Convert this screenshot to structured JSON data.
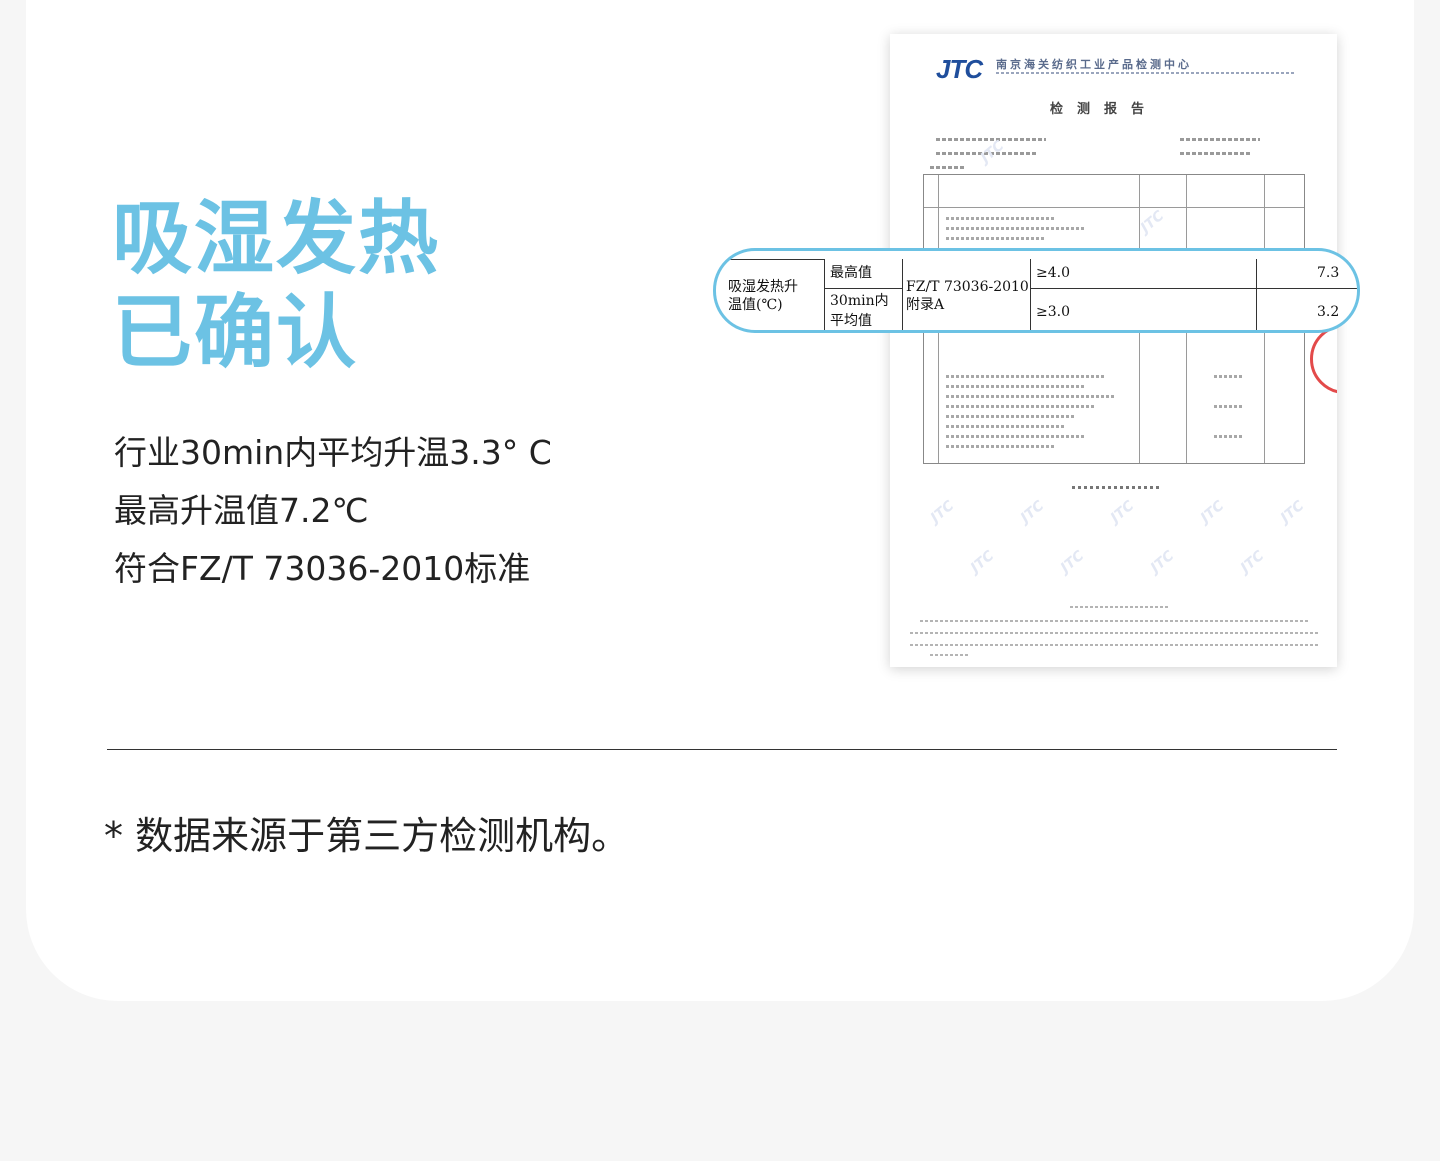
{
  "headline": {
    "line1": "吸湿发热",
    "line2": "已确认"
  },
  "specs": [
    "行业30min内平均升温3.3° C",
    "最高升温值7.2℃",
    "符合FZ/T 73036-2010标准"
  ],
  "footnote": "* 数据来源于第三方检测机构。",
  "report": {
    "logo": "JTC",
    "org_name": "南京海关纺织工业产品检测中心",
    "title": "检测报告"
  },
  "highlight_table": {
    "item": "吸湿发热升温值(℃)",
    "item_line1": "吸湿发热升",
    "item_line2": "温值(℃)",
    "rows": [
      {
        "metric": "最高值",
        "requirement": "≥4.0",
        "result": "7.3"
      },
      {
        "metric_line1": "30min内",
        "metric_line2": "平均值",
        "requirement": "≥3.0",
        "result": "3.2"
      }
    ],
    "standard_line1": "FZ/T 73036-2010",
    "standard_line2": "附录A"
  },
  "colors": {
    "accent": "#6cc2e4",
    "text": "#222222",
    "background": "#f6f6f6",
    "card": "#ffffff",
    "logo_blue": "#1f4e9c",
    "stamp_red": "#e34a4a"
  }
}
